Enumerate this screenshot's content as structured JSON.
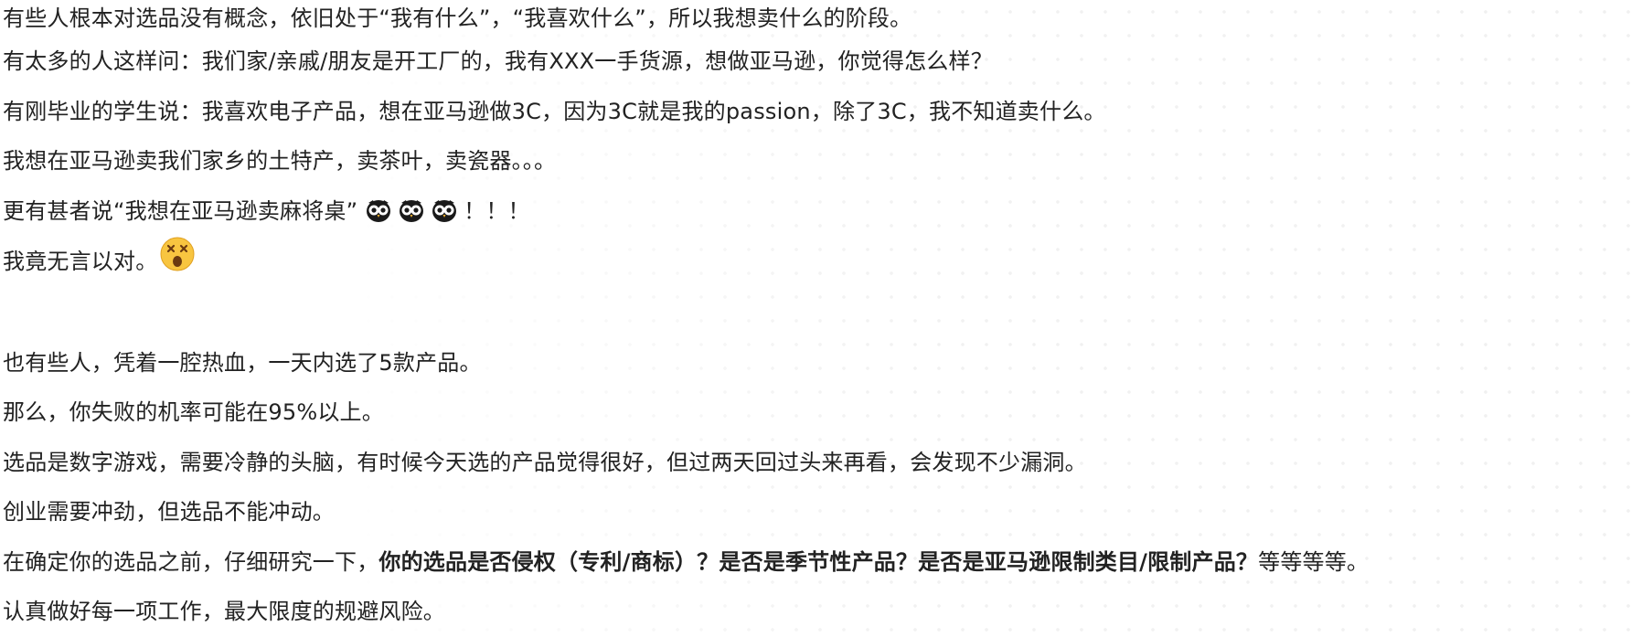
{
  "paragraphs": {
    "p1": "有些人根本对选品没有概念，依旧处于“我有什么”，“我喜欢什么”，所以我想卖什么的阶段。",
    "p2": "有太多的人这样问：我们家/亲戚/朋友是开工厂的，我有XXX一手货源，想做亚马逊，你觉得怎么样？",
    "p3": "有刚毕业的学生说：我喜欢电子产品，想在亚马逊做3C，因为3C就是我的passion，除了3C，我不知道卖什么。",
    "p4": "我想在亚马逊卖我们家乡的土特产，卖茶叶，卖瓷器。。。",
    "p5_text": "更有甚者说“我想在亚马逊卖麻将桌”",
    "p5_end": "！！！",
    "p6": "我竟无言以对。",
    "p7": "也有些人，凭着一腔热血，一天内选了5款产品。",
    "p8": "那么，你失败的机率可能在95%以上。",
    "p9": "选品是数字游戏，需要冷静的头脑，有时候今天选的产品觉得很好，但过两天回过头来再看，会发现不少漏洞。",
    "p10": "创业需要冲劲，但选品不能冲动。",
    "p11_pre": "在确定你的选品之前，仔细研究一下，",
    "p11_bold": "你的选品是否侵权（专利/商标）？是否是季节性产品？是否是亚马逊限制类目/限制产品？",
    "p11_post": "等等等等。",
    "p12": "认真做好每一项工作，最大限度的规避风险。"
  },
  "icons": {
    "owl": "owl-emoji-icon",
    "dizzy": "dizzy-face-emoji-icon"
  }
}
